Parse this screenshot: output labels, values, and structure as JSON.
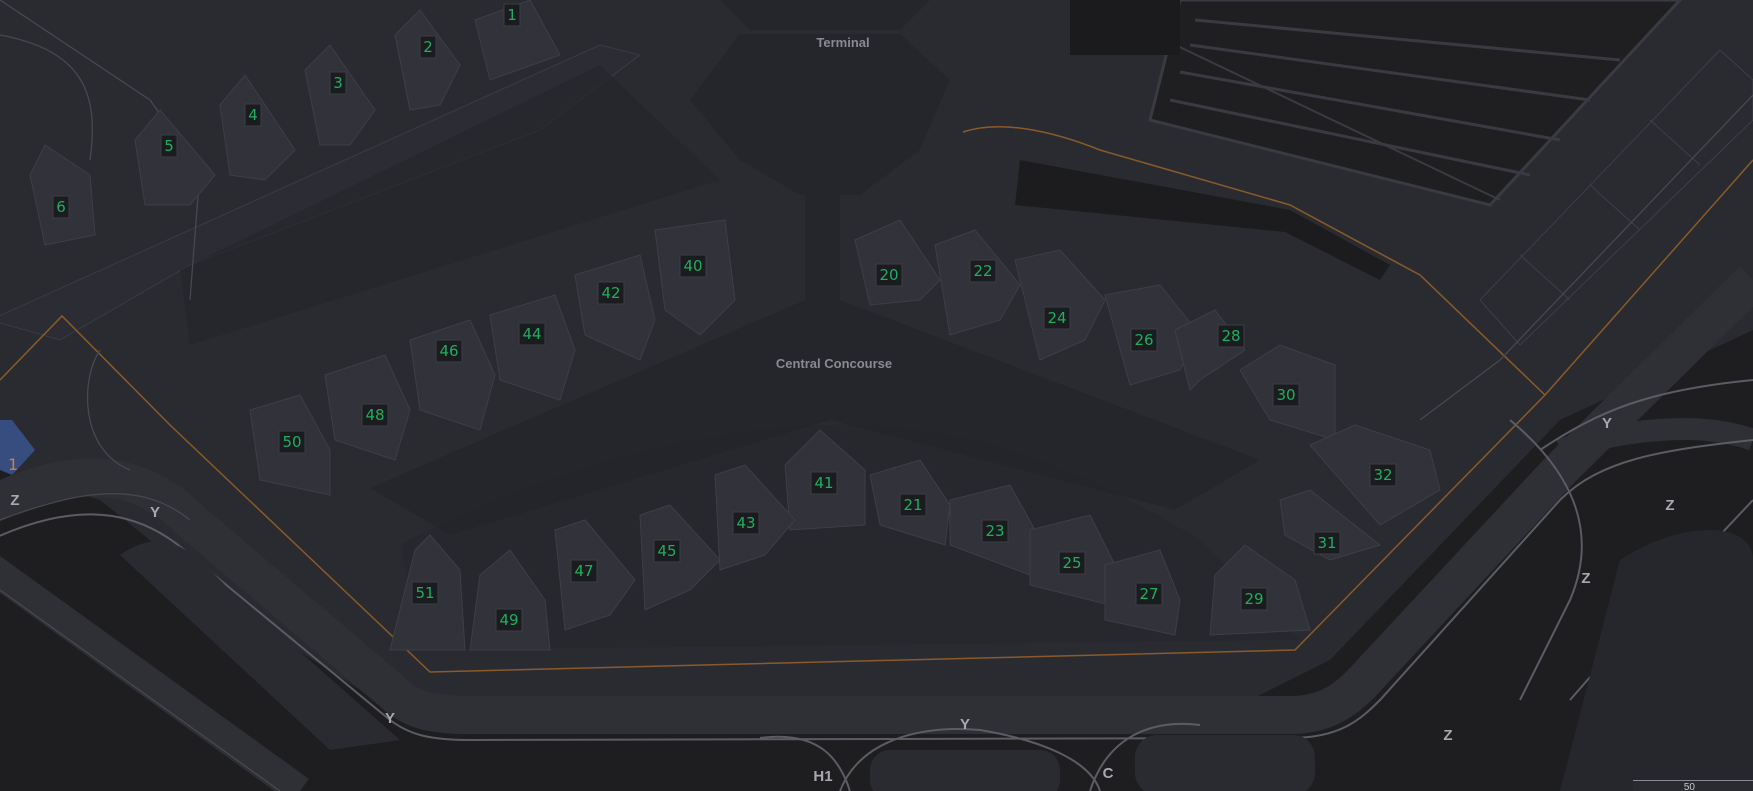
{
  "map": {
    "area_labels": [
      {
        "id": "terminal",
        "text": "Terminal"
      },
      {
        "id": "central-concourse",
        "text": "Central Concourse"
      }
    ],
    "gates": [
      "1",
      "2",
      "3",
      "4",
      "5",
      "6",
      "40",
      "42",
      "44",
      "46",
      "48",
      "50",
      "20",
      "22",
      "24",
      "26",
      "28",
      "30",
      "32",
      "41",
      "43",
      "45",
      "47",
      "51",
      "49",
      "21",
      "23",
      "25",
      "27",
      "29",
      "31"
    ],
    "taxiways": [
      "Y",
      "Y",
      "Y",
      "Y",
      "Z",
      "Z",
      "Z",
      "Z",
      "H1",
      "C"
    ],
    "overlay_marker": "1",
    "scale_text": "50"
  }
}
